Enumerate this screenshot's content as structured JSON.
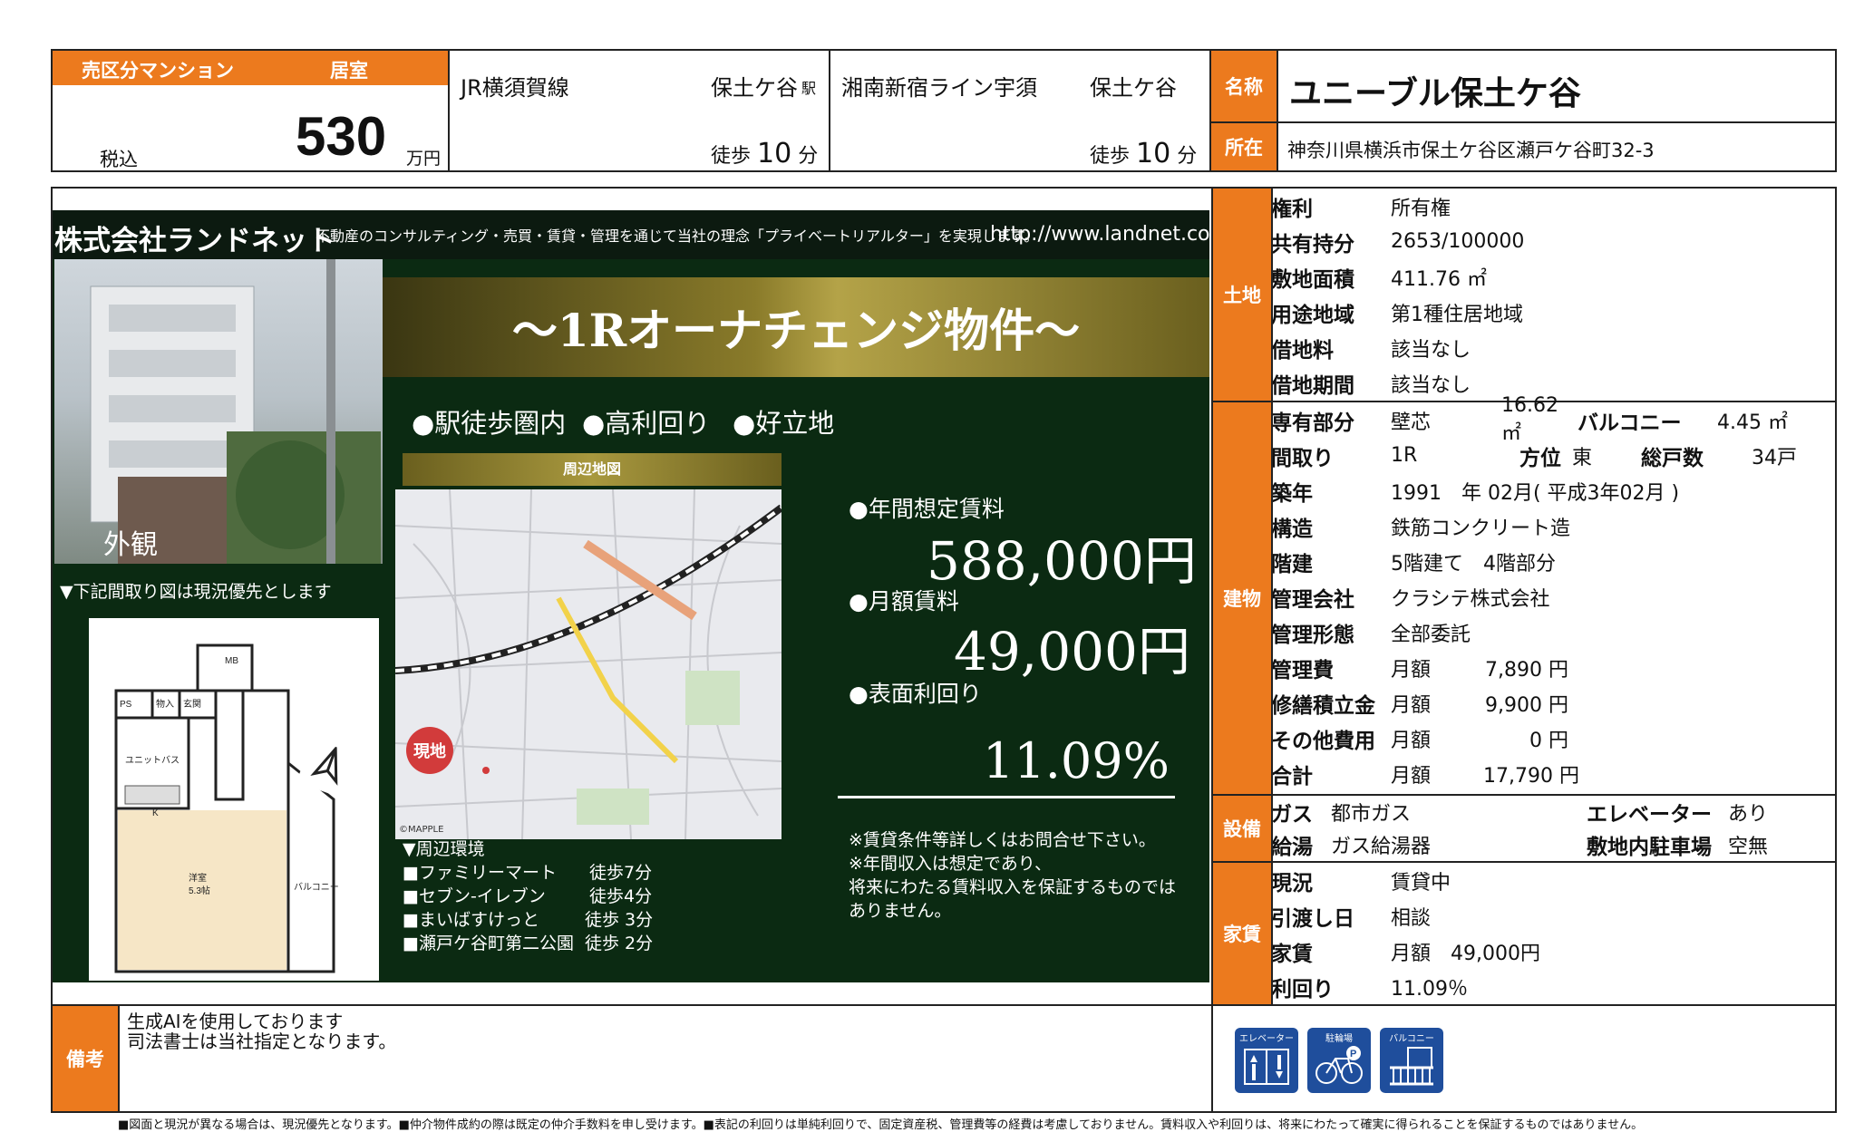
{
  "header": {
    "property_type": "売区分マンション",
    "room_type": "居室",
    "tax_label": "税込",
    "price": "530",
    "price_unit": "万円",
    "station1_line": "JR横須賀線",
    "station1_name": "保土ケ谷",
    "station1_suffix": "駅",
    "station1_walk_prefix": "徒歩",
    "station1_walk": "10",
    "station1_walk_unit": "分",
    "station2_line": "湘南新宿ライン宇須",
    "station2_name": "保土ケ谷",
    "station2_walk_prefix": "徒歩",
    "station2_walk": "10",
    "station2_walk_unit": "分",
    "name_label": "名称",
    "name": "ユニーブル保土ケ谷",
    "address_label": "所在",
    "address": "神奈川県横浜市保土ケ谷区瀬戸ケ谷町32-3"
  },
  "flyer": {
    "company": "株式会社ランドネット",
    "tagline": "不動産のコンサルティング・売買・賃貸・管理を通じて当社の理念「プライベートリアルター」を実現します。",
    "url": "http://www.landnet.co.jp",
    "banner": "～1Rオーナチェンジ物件～",
    "features": [
      "●駅徒歩圏内",
      "●高利回り",
      "●好立地"
    ],
    "exterior_label": "外観",
    "floorplan_note": "▼下記間取り図は現況優先とします",
    "map_title": "周辺地図",
    "map_here": "現地",
    "map_credit": "©MAPPLE",
    "annual_rent_label": "●年間想定賃料",
    "annual_rent": "588,000円",
    "monthly_rent_label": "●月額賃料",
    "monthly_rent": "49,000円",
    "yield_label": "●表面利回り",
    "yield": "11.09%",
    "notes": [
      "※賃貸条件等詳しくはお問合せ下さい。",
      "※年間収入は想定であり、",
      "将来にわたる賃料収入を保証するものでは",
      "ありません。"
    ],
    "env_title": "▼周辺環境",
    "env": [
      {
        "name": "■ファミリーマート",
        "walk": "徒歩7分"
      },
      {
        "name": "■セブン-イレブン",
        "walk": "徒歩4分"
      },
      {
        "name": "■まいばすけっと",
        "walk": "徒歩 3分"
      },
      {
        "name": "■瀬戸ケ谷町第二公園",
        "walk": "徒歩 2分"
      }
    ],
    "plan_labels": {
      "ps": "PS",
      "mb": "MB",
      "storage": "物入",
      "entrance": "玄関",
      "bath": "ユニットバス",
      "kitchen": "K",
      "room": "洋室",
      "room_size": "5.3帖",
      "balcony": "バルコニー"
    }
  },
  "land": {
    "section": "土地",
    "rows": [
      {
        "label": "権利",
        "value": "所有権"
      },
      {
        "label": "共有持分",
        "value": "2653/100000"
      },
      {
        "label": "敷地面積",
        "value": "411.76 ㎡"
      },
      {
        "label": "用途地域",
        "value": "第1種住居地域"
      },
      {
        "label": "借地料",
        "value": "該当なし"
      },
      {
        "label": "借地期間",
        "value": "該当なし"
      }
    ]
  },
  "building": {
    "section": "建物",
    "exclusive_label": "専有部分",
    "exclusive_type": "壁芯",
    "exclusive_area": "16.62㎡",
    "balcony_label": "バルコニー",
    "balcony_area": "4.45 ㎡",
    "layout_label": "間取り",
    "layout": "1R",
    "direction_label": "方位",
    "direction": "東",
    "units_label": "総戸数",
    "units": "34戸",
    "built_label": "築年",
    "built": "1991　年 02月( 平成3年02月 )",
    "structure_label": "構造",
    "structure": "鉄筋コンクリート造",
    "floors_label": "階建",
    "floors": "5階建て　4階部分",
    "mgmt_company_label": "管理会社",
    "mgmt_company": "クラシテ株式会社",
    "mgmt_form_label": "管理形態",
    "mgmt_form": "全部委託",
    "fees": [
      {
        "label": "管理費",
        "period": "月額",
        "amount": "7,890 円"
      },
      {
        "label": "修繕積立金",
        "period": "月額",
        "amount": "9,900 円"
      },
      {
        "label": "その他費用",
        "period": "月額",
        "amount": "0 円"
      },
      {
        "label": "合計",
        "period": "月額",
        "amount": "17,790 円"
      }
    ]
  },
  "facilities": {
    "section": "設備",
    "gas_label": "ガス",
    "gas": "都市ガス",
    "elevator_label": "エレベーター",
    "elevator": "あり",
    "water_label": "給湯",
    "water": "ガス給湯器",
    "parking_label": "敷地内駐車場",
    "parking": "空無"
  },
  "rent": {
    "section": "家賃",
    "status_label": "現況",
    "status": "賃貸中",
    "handover_label": "引渡し日",
    "handover": "相談",
    "rent_label": "家賃",
    "rent_period": "月額",
    "rent": "49,000円",
    "yield_label": "利回り",
    "yield": "11.09％"
  },
  "remarks": {
    "label": "備考",
    "lines": [
      "生成AIを使用しております",
      "司法書士は当社指定となります。"
    ]
  },
  "icons": [
    {
      "name": "elevator-icon",
      "label": "エレベーター"
    },
    {
      "name": "bicycle-parking-icon",
      "label": "駐輪場"
    },
    {
      "name": "balcony-icon",
      "label": "バルコニー"
    }
  ],
  "footer": "■図面と現況が異なる場合は、現況優先となります。■仲介物件成約の際は既定の仲介手数料を申し受けます。■表記の利回りは単純利回りで、固定資産税、管理費等の経費は考慮しておりません。賃料収入や利回りは、将来にわたって確実に得られることを保証するものではありません。",
  "colors": {
    "accent": "#ec7a1e",
    "flyer_bg": "#0b2a12",
    "icon_blue": "#1f4e9c"
  }
}
